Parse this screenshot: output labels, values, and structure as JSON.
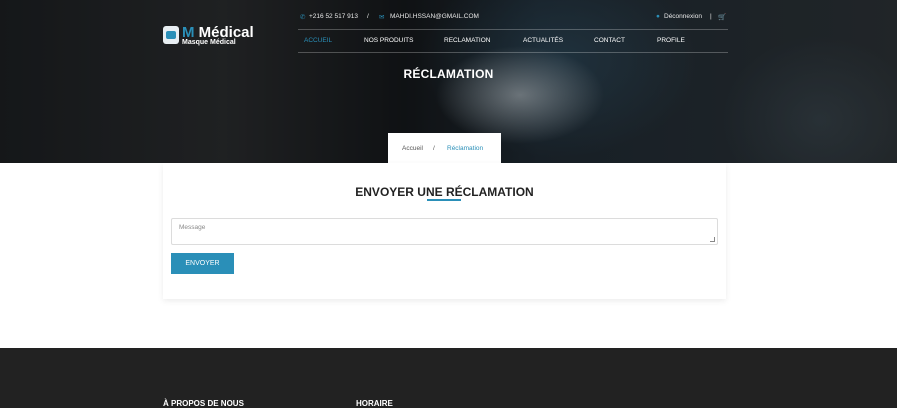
{
  "brand": {
    "name_prefix": "M",
    "name": "Médical",
    "tagline": "Masque Médical"
  },
  "topbar": {
    "phone": "+216 52 517 913",
    "separator": "/",
    "email": "MAHDI.HSSAN@GMAIL.COM",
    "logout": "Déconnexion",
    "pipe": "|"
  },
  "nav": {
    "items": [
      {
        "label": "ACCUEIL",
        "active": true
      },
      {
        "label": "NOS PRODUITS",
        "active": false
      },
      {
        "label": "RECLAMATION",
        "active": false
      },
      {
        "label": "ACTUALITÉS",
        "active": false
      },
      {
        "label": "CONTACT",
        "active": false
      },
      {
        "label": "PROFILE",
        "active": false
      }
    ]
  },
  "hero": {
    "title": "RÉCLAMATION"
  },
  "breadcrumb": {
    "home": "Accueil",
    "separator": "/",
    "current": "Réclamation"
  },
  "form": {
    "title": "ENVOYER UNE RÉCLAMATION",
    "message_placeholder": "Message",
    "message_value": "",
    "submit_label": "ENVOYER"
  },
  "footer": {
    "about_heading": "À PROPOS DE NOUS",
    "hours_heading": "HORAIRE"
  },
  "colors": {
    "accent": "#2a8fb8",
    "footer_bg": "#222222",
    "text_dark": "#222222"
  },
  "icons": {
    "phone": "phone-icon",
    "email": "email-icon",
    "lock": "lock-icon",
    "cart": "cart-icon",
    "logo": "mask-logo-icon"
  }
}
